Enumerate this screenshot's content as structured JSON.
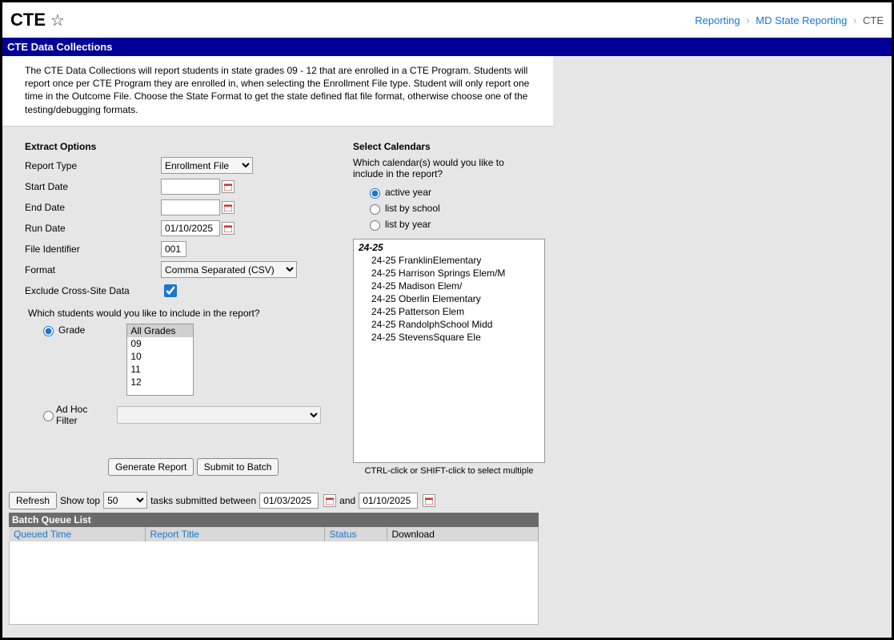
{
  "header": {
    "title": "CTE",
    "breadcrumb": [
      "Reporting",
      "MD State Reporting",
      "CTE"
    ]
  },
  "panel": {
    "title": "CTE Data Collections",
    "description": "The CTE Data Collections will report students in state grades 09 - 12 that are enrolled in a CTE Program. Students will report once per CTE Program they are enrolled in, when selecting the Enrollment File type. Student will only report one time in the Outcome File. Choose the State Format to get the state defined flat file format, otherwise choose one of the testing/debugging formats."
  },
  "extract": {
    "section_title": "Extract Options",
    "labels": {
      "report_type": "Report Type",
      "start_date": "Start Date",
      "end_date": "End Date",
      "run_date": "Run Date",
      "file_identifier": "File Identifier",
      "format": "Format",
      "exclude_cross": "Exclude Cross-Site Data"
    },
    "report_type_value": "Enrollment File",
    "start_date_value": "",
    "end_date_value": "",
    "run_date_value": "01/10/2025",
    "file_identifier_value": "001",
    "format_value": "Comma Separated (CSV)",
    "exclude_checked": true,
    "student_question": "Which students would you like to include in the report?",
    "student_options": {
      "grade": "Grade",
      "adhoc": "Ad Hoc Filter"
    },
    "grades": [
      "All Grades",
      "09",
      "10",
      "11",
      "12"
    ],
    "grade_selected": "All Grades",
    "buttons": {
      "generate": "Generate Report",
      "submit": "Submit to Batch"
    }
  },
  "calendars": {
    "section_title": "Select Calendars",
    "question": "Which calendar(s) would you like to include in the report?",
    "options": {
      "active": "active year",
      "school": "list by school",
      "year": "list by year"
    },
    "year_group": "24-25",
    "schools": [
      "24-25 FranklinElementary",
      "24-25 Harrison Springs Elem/M",
      "24-25 Madison Elem/",
      "24-25 Oberlin Elementary",
      "24-25 Patterson Elem",
      "24-25 RandolphSchool Midd",
      "24-25 StevensSquare Ele"
    ],
    "hint": "CTRL-click or SHIFT-click to select multiple"
  },
  "queue": {
    "refresh": "Refresh",
    "show_top_label": "Show top",
    "show_top_value": "50",
    "between_label": "tasks submitted between",
    "from_date": "01/03/2025",
    "and_label": "and",
    "to_date": "01/10/2025",
    "list_title": "Batch Queue List",
    "columns": {
      "queued": "Queued Time",
      "report": "Report Title",
      "status": "Status",
      "download": "Download"
    }
  }
}
